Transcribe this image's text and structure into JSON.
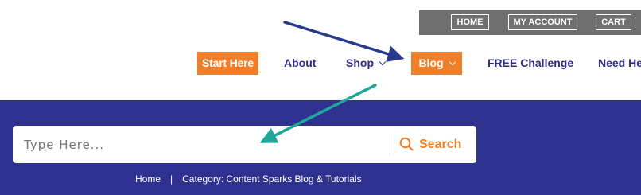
{
  "utility_bar": {
    "home": "HOME",
    "account": "MY ACCOUNT",
    "cart": "CART"
  },
  "nav": {
    "start_here": "Start Here",
    "about": "About",
    "shop": "Shop",
    "blog": "Blog",
    "free_challenge": "FREE Challenge",
    "need_help": "Need Hel"
  },
  "search": {
    "placeholder": "Type Here...",
    "button_label": "Search"
  },
  "breadcrumb": {
    "home": "Home",
    "separator": "|",
    "current": "Category: Content Sparks Blog & Tutorials"
  },
  "colors": {
    "accent_orange": "#f07f2b",
    "hero_blue": "#2e3190",
    "nav_text": "#2b2d87",
    "utility_bar": "#6f6f6f",
    "annotation_arrow_navy": "#283a8c",
    "annotation_arrow_teal": "#1fa79a"
  }
}
